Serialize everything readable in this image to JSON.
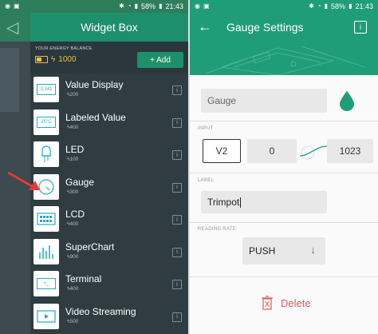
{
  "status_bar": {
    "battery_percent": "58%",
    "time": "21:43"
  },
  "widget_box": {
    "title": "Widget Box",
    "energy_label": "YOUR ENERGY BALANCE",
    "energy_value": "1000",
    "add_label": "+ Add",
    "info_glyph": "i",
    "items": [
      {
        "name": "Value Display",
        "cost": "200",
        "thumb": "3,141"
      },
      {
        "name": "Labeled Value",
        "cost": "400",
        "thumb": "25°C"
      },
      {
        "name": "LED",
        "cost": "100",
        "thumb": ""
      },
      {
        "name": "Gauge",
        "cost": "300",
        "thumb": ""
      },
      {
        "name": "LCD",
        "cost": "400",
        "thumb": ""
      },
      {
        "name": "SuperChart",
        "cost": "900",
        "thumb": ""
      },
      {
        "name": "Terminal",
        "cost": "400",
        "thumb": ">_"
      },
      {
        "name": "Video Streaming",
        "cost": "500",
        "thumb": ""
      }
    ]
  },
  "gauge_settings": {
    "title": "Gauge Settings",
    "back_glyph": "←",
    "info_glyph": "i",
    "name_value": "Gauge",
    "input_label": "INPUT",
    "pin": "V2",
    "min": "0",
    "max": "1023",
    "label_label": "LABEL",
    "label_value": "Trimpot",
    "reading_rate_label": "READING RATE",
    "reading_rate_value": "PUSH",
    "delete_label": "Delete"
  },
  "colors": {
    "accent": "#1f9d78",
    "drawer_bg": "#2f3d43",
    "energy_gold": "#f0c040",
    "delete_red": "#e05a5a",
    "drop_color": "#1e9e78",
    "pointer_red": "#e53935"
  }
}
